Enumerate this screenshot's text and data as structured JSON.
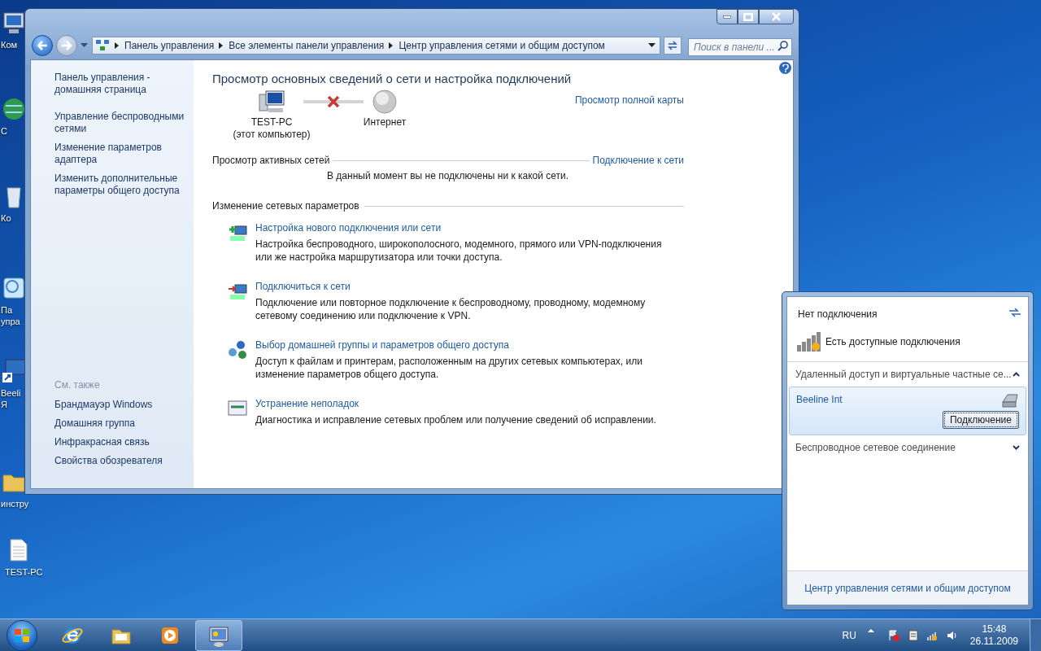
{
  "desktop_icons": [
    {
      "kind": "computer",
      "lines": [
        "Ком"
      ]
    },
    {
      "kind": "globe",
      "lines": [
        "С"
      ]
    },
    {
      "kind": "bin",
      "lines": [
        "Ко"
      ]
    },
    {
      "kind": "panel",
      "lines": [
        "Па",
        "упра"
      ]
    },
    {
      "kind": "shortcut",
      "lines": [
        "Beeli",
        "Я"
      ]
    },
    {
      "kind": "folder",
      "lines": [
        "инстру"
      ]
    },
    {
      "kind": "file",
      "lines": [
        "TEST-PC"
      ]
    }
  ],
  "window": {
    "address_bar": {
      "segments": [
        "Панель управления",
        "Все элементы панели управления",
        "Центр управления сетями и общим доступом"
      ]
    },
    "search": {
      "placeholder": "Поиск в панели ..."
    },
    "sidebar": {
      "links": [
        "Панель управления - домашняя страница",
        "Управление беспроводными сетями",
        "Изменение параметров адаптера",
        "Изменить дополнительные параметры общего доступа"
      ],
      "see_also_title": "См. также",
      "see_also": [
        "Брандмауэр Windows",
        "Домашняя группа",
        "Инфракрасная связь",
        "Свойства обозревателя"
      ]
    },
    "main": {
      "title": "Просмотр основных сведений о сети и настройка подключений",
      "map": {
        "computer_name": "TEST-PC",
        "computer_caption": "(этот компьютер)",
        "internet": "Интернет",
        "connected": false
      },
      "full_map_link": "Просмотр полной карты",
      "active_networks": {
        "heading": "Просмотр активных сетей",
        "link": "Подключение к сети",
        "message": "В данный момент вы не подключены ни к какой сети."
      },
      "change_settings": {
        "heading": "Изменение сетевых параметров",
        "tasks": [
          {
            "kind": "new",
            "title": "Настройка нового подключения или сети",
            "description": "Настройка беспроводного, широкополосного, модемного, прямого или VPN-подключения или же настройка маршрутизатора или точки доступа."
          },
          {
            "kind": "connect",
            "title": "Подключиться к сети",
            "description": "Подключение или повторное подключение к беспроводному, проводному, модемному сетевому соединению или подключение к VPN."
          },
          {
            "kind": "homegroup",
            "title": "Выбор домашней группы и параметров общего доступа",
            "description": "Доступ к файлам и принтерам, расположенным на других сетевых компьютерах, или изменение параметров общего доступа."
          },
          {
            "kind": "troubleshoot",
            "title": "Устранение неполадок",
            "description": "Диагностика и исправление сетевых проблем или получение сведений об исправлении."
          }
        ]
      }
    }
  },
  "network_popup": {
    "status": "Нет подключения",
    "available": "Есть доступные подключения",
    "sections": [
      {
        "title": "Удаленный доступ и виртуальные частные се...",
        "expanded": true,
        "items": [
          {
            "name": "Beeline Int",
            "selected": true,
            "button": "Подключение"
          }
        ]
      },
      {
        "title": "Беспроводное сетевое соединение",
        "expanded": false
      }
    ],
    "footer_link": "Центр управления сетями и общим доступом"
  },
  "taskbar": {
    "apps": [
      {
        "kind": "browser",
        "active": false
      },
      {
        "kind": "explorer",
        "active": false
      },
      {
        "kind": "media",
        "active": false
      },
      {
        "kind": "control-panel",
        "active": true
      }
    ],
    "language": "RU",
    "time": "15:48",
    "date": "26.11.2009"
  }
}
